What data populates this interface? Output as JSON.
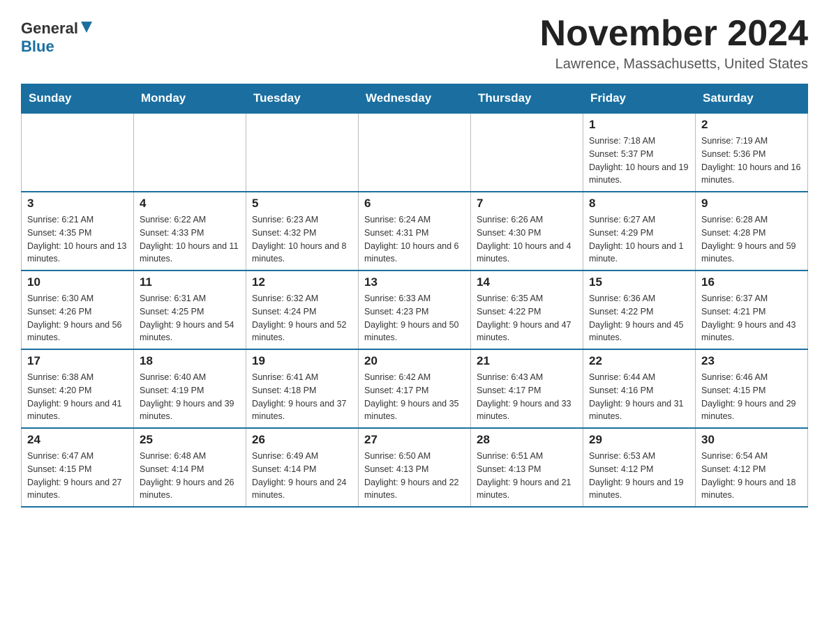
{
  "header": {
    "logo_general": "General",
    "logo_blue": "Blue",
    "month_title": "November 2024",
    "location": "Lawrence, Massachusetts, United States"
  },
  "weekdays": [
    "Sunday",
    "Monday",
    "Tuesday",
    "Wednesday",
    "Thursday",
    "Friday",
    "Saturday"
  ],
  "weeks": [
    [
      {
        "day": "",
        "info": ""
      },
      {
        "day": "",
        "info": ""
      },
      {
        "day": "",
        "info": ""
      },
      {
        "day": "",
        "info": ""
      },
      {
        "day": "",
        "info": ""
      },
      {
        "day": "1",
        "info": "Sunrise: 7:18 AM\nSunset: 5:37 PM\nDaylight: 10 hours and 19 minutes."
      },
      {
        "day": "2",
        "info": "Sunrise: 7:19 AM\nSunset: 5:36 PM\nDaylight: 10 hours and 16 minutes."
      }
    ],
    [
      {
        "day": "3",
        "info": "Sunrise: 6:21 AM\nSunset: 4:35 PM\nDaylight: 10 hours and 13 minutes."
      },
      {
        "day": "4",
        "info": "Sunrise: 6:22 AM\nSunset: 4:33 PM\nDaylight: 10 hours and 11 minutes."
      },
      {
        "day": "5",
        "info": "Sunrise: 6:23 AM\nSunset: 4:32 PM\nDaylight: 10 hours and 8 minutes."
      },
      {
        "day": "6",
        "info": "Sunrise: 6:24 AM\nSunset: 4:31 PM\nDaylight: 10 hours and 6 minutes."
      },
      {
        "day": "7",
        "info": "Sunrise: 6:26 AM\nSunset: 4:30 PM\nDaylight: 10 hours and 4 minutes."
      },
      {
        "day": "8",
        "info": "Sunrise: 6:27 AM\nSunset: 4:29 PM\nDaylight: 10 hours and 1 minute."
      },
      {
        "day": "9",
        "info": "Sunrise: 6:28 AM\nSunset: 4:28 PM\nDaylight: 9 hours and 59 minutes."
      }
    ],
    [
      {
        "day": "10",
        "info": "Sunrise: 6:30 AM\nSunset: 4:26 PM\nDaylight: 9 hours and 56 minutes."
      },
      {
        "day": "11",
        "info": "Sunrise: 6:31 AM\nSunset: 4:25 PM\nDaylight: 9 hours and 54 minutes."
      },
      {
        "day": "12",
        "info": "Sunrise: 6:32 AM\nSunset: 4:24 PM\nDaylight: 9 hours and 52 minutes."
      },
      {
        "day": "13",
        "info": "Sunrise: 6:33 AM\nSunset: 4:23 PM\nDaylight: 9 hours and 50 minutes."
      },
      {
        "day": "14",
        "info": "Sunrise: 6:35 AM\nSunset: 4:22 PM\nDaylight: 9 hours and 47 minutes."
      },
      {
        "day": "15",
        "info": "Sunrise: 6:36 AM\nSunset: 4:22 PM\nDaylight: 9 hours and 45 minutes."
      },
      {
        "day": "16",
        "info": "Sunrise: 6:37 AM\nSunset: 4:21 PM\nDaylight: 9 hours and 43 minutes."
      }
    ],
    [
      {
        "day": "17",
        "info": "Sunrise: 6:38 AM\nSunset: 4:20 PM\nDaylight: 9 hours and 41 minutes."
      },
      {
        "day": "18",
        "info": "Sunrise: 6:40 AM\nSunset: 4:19 PM\nDaylight: 9 hours and 39 minutes."
      },
      {
        "day": "19",
        "info": "Sunrise: 6:41 AM\nSunset: 4:18 PM\nDaylight: 9 hours and 37 minutes."
      },
      {
        "day": "20",
        "info": "Sunrise: 6:42 AM\nSunset: 4:17 PM\nDaylight: 9 hours and 35 minutes."
      },
      {
        "day": "21",
        "info": "Sunrise: 6:43 AM\nSunset: 4:17 PM\nDaylight: 9 hours and 33 minutes."
      },
      {
        "day": "22",
        "info": "Sunrise: 6:44 AM\nSunset: 4:16 PM\nDaylight: 9 hours and 31 minutes."
      },
      {
        "day": "23",
        "info": "Sunrise: 6:46 AM\nSunset: 4:15 PM\nDaylight: 9 hours and 29 minutes."
      }
    ],
    [
      {
        "day": "24",
        "info": "Sunrise: 6:47 AM\nSunset: 4:15 PM\nDaylight: 9 hours and 27 minutes."
      },
      {
        "day": "25",
        "info": "Sunrise: 6:48 AM\nSunset: 4:14 PM\nDaylight: 9 hours and 26 minutes."
      },
      {
        "day": "26",
        "info": "Sunrise: 6:49 AM\nSunset: 4:14 PM\nDaylight: 9 hours and 24 minutes."
      },
      {
        "day": "27",
        "info": "Sunrise: 6:50 AM\nSunset: 4:13 PM\nDaylight: 9 hours and 22 minutes."
      },
      {
        "day": "28",
        "info": "Sunrise: 6:51 AM\nSunset: 4:13 PM\nDaylight: 9 hours and 21 minutes."
      },
      {
        "day": "29",
        "info": "Sunrise: 6:53 AM\nSunset: 4:12 PM\nDaylight: 9 hours and 19 minutes."
      },
      {
        "day": "30",
        "info": "Sunrise: 6:54 AM\nSunset: 4:12 PM\nDaylight: 9 hours and 18 minutes."
      }
    ]
  ]
}
